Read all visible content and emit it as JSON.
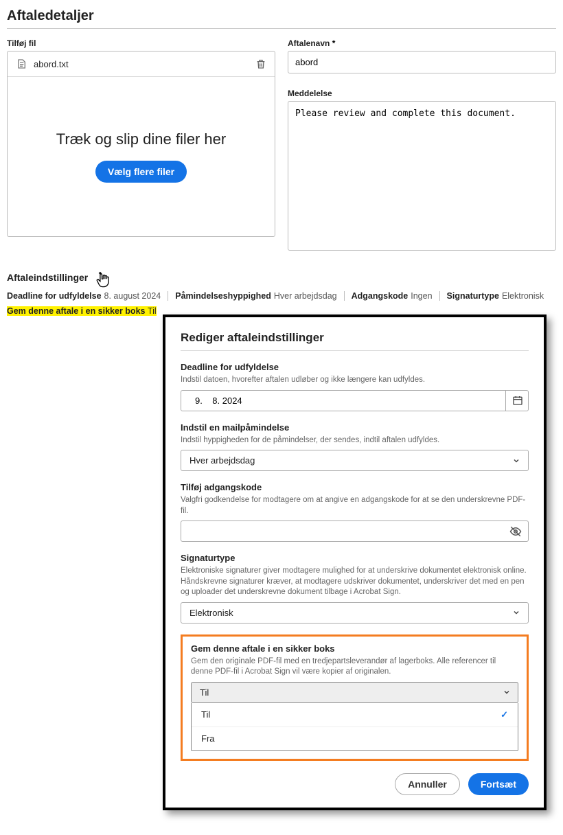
{
  "page": {
    "title": "Aftaledetaljer",
    "addFileLabel": "Tilføj fil",
    "fileName": "abord.txt",
    "dropText": "Træk og slip dine filer her",
    "chooseMore": "Vælg flere filer",
    "agreementNameLabel": "Aftalenavn",
    "agreementNameValue": "abord",
    "messageLabel": "Meddelelse",
    "messageValue": "Please review and complete this document.",
    "settingsHeader": "Aftaleindstillinger",
    "summary": {
      "deadlineLabel": "Deadline for udfyldelse",
      "deadlineValue": "8. august 2024",
      "reminderLabel": "Påmindelseshyppighed",
      "reminderValue": "Hver arbejdsdag",
      "passwordLabel": "Adgangskode",
      "passwordValue": "Ingen",
      "sigLabel": "Signaturtype",
      "sigValue": "Elektronisk",
      "vaultLabel": "Gem denne aftale i en sikker boks",
      "vaultValue": "Til"
    }
  },
  "modal": {
    "title": "Rediger aftaleindstillinger",
    "deadline": {
      "title": "Deadline for udfyldelse",
      "desc": "Indstil datoen, hvorefter aftalen udløber og ikke længere kan udfyldes.",
      "value": "9.    8. 2024"
    },
    "reminder": {
      "title": "Indstil en mailpåmindelse",
      "desc": "Indstil hyppigheden for de påmindelser, der sendes, indtil aftalen udfyldes.",
      "value": "Hver arbejdsdag"
    },
    "password": {
      "title": "Tilføj adgangskode",
      "desc": "Valgfri godkendelse for modtagere om at angive en adgangskode for at se den underskrevne PDF-fil.",
      "value": ""
    },
    "sig": {
      "title": "Signaturtype",
      "desc": "Elektroniske signaturer giver modtagere mulighed for at underskrive dokumentet elektronisk online. Håndskrevne signaturer kræver, at modtagere udskriver dokumentet, underskriver det med en pen og uploader det underskrevne dokument tilbage i Acrobat Sign.",
      "value": "Elektronisk"
    },
    "vault": {
      "title": "Gem denne aftale i en sikker boks",
      "desc": "Gem den originale PDF-fil med en tredjepartsleverandør af lagerboks. Alle referencer til denne PDF-fil i Acrobat Sign vil være kopier af originalen.",
      "selected": "Til",
      "optOn": "Til",
      "optOff": "Fra"
    },
    "cancel": "Annuller",
    "continue": "Fortsæt"
  }
}
